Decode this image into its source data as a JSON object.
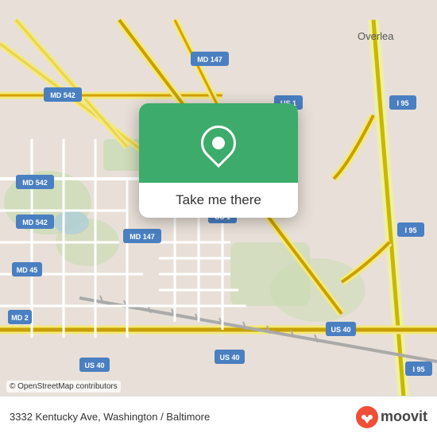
{
  "map": {
    "background_color": "#e8e0d8",
    "attribution": "© OpenStreetMap contributors"
  },
  "popup": {
    "button_label": "Take me there",
    "pin_icon": "location-pin"
  },
  "bottom_bar": {
    "address": "3332 Kentucky Ave, Washington / Baltimore"
  },
  "moovit": {
    "logo_text": "moovit"
  },
  "route_badges": [
    {
      "id": "md542_1",
      "label": "MD 542"
    },
    {
      "id": "md542_2",
      "label": "MD 542"
    },
    {
      "id": "md542_3",
      "label": "MD 542"
    },
    {
      "id": "md147_1",
      "label": "MD 147"
    },
    {
      "id": "md147_2",
      "label": "MD 147"
    },
    {
      "id": "us1_1",
      "label": "US 1"
    },
    {
      "id": "us1_2",
      "label": "US 1"
    },
    {
      "id": "md45",
      "label": "MD 45"
    },
    {
      "id": "md2",
      "label": "MD 2"
    },
    {
      "id": "us40_1",
      "label": "US 40"
    },
    {
      "id": "us40_2",
      "label": "US 40"
    },
    {
      "id": "us40_3",
      "label": "US 40"
    },
    {
      "id": "i95_1",
      "label": "I 95"
    },
    {
      "id": "i95_2",
      "label": "I 95"
    },
    {
      "id": "i95_3",
      "label": "I 95"
    }
  ]
}
